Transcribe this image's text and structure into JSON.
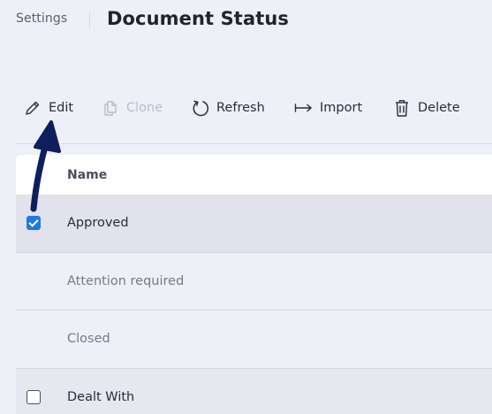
{
  "header": {
    "breadcrumb": "Settings",
    "title": "Document Status"
  },
  "toolbar": {
    "edit": {
      "label": "Edit",
      "icon": "pencil-icon"
    },
    "clone": {
      "label": "Clone",
      "icon": "copy-icon",
      "disabled": true
    },
    "refresh": {
      "label": "Refresh",
      "icon": "refresh-icon"
    },
    "import": {
      "label": "Import",
      "icon": "import-arrow-icon"
    },
    "delete": {
      "label": "Delete",
      "icon": "trash-icon"
    }
  },
  "table": {
    "columns": [
      "Name"
    ],
    "rows": [
      {
        "name": "Approved",
        "checked": true,
        "selected": true
      },
      {
        "name": "Attention required",
        "checked": false
      },
      {
        "name": "Closed",
        "checked": false
      },
      {
        "name": "Dealt With",
        "checked": false
      }
    ]
  },
  "colors": {
    "accent": "#1f7ae0",
    "annotation_arrow": "#0f1f5c",
    "background": "#eef0f8"
  }
}
